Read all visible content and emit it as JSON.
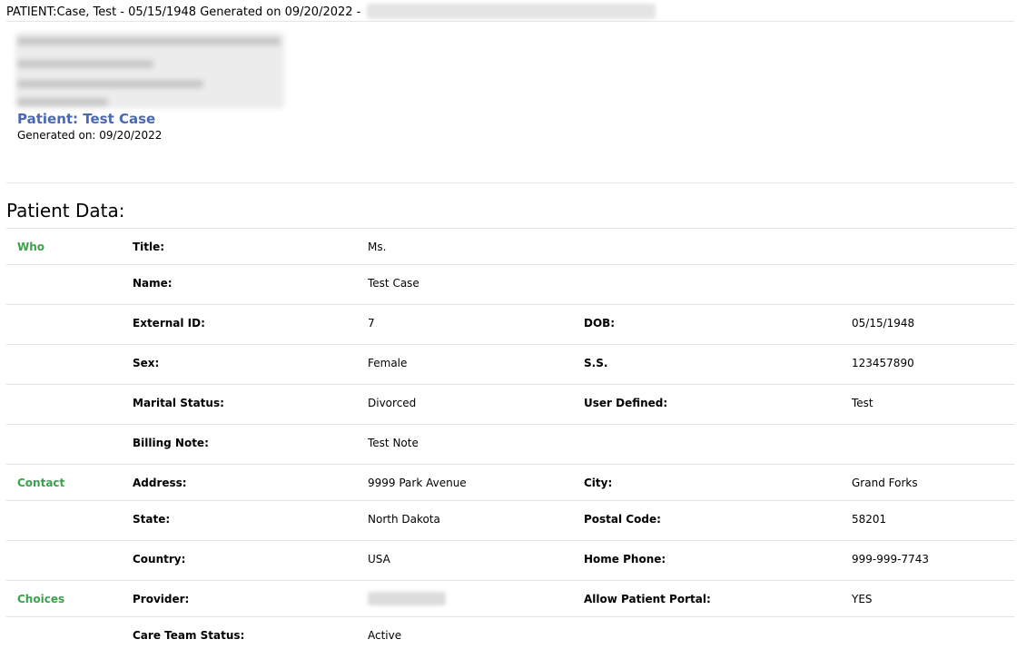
{
  "top_bar": {
    "text": "PATIENT:Case, Test - 05/15/1948 Generated on 09/20/2022 -"
  },
  "header": {
    "patient_title": "Patient: Test Case",
    "generated_on": "Generated on: 09/20/2022"
  },
  "section": {
    "heading": "Patient Data:"
  },
  "rows": [
    {
      "group": "Who",
      "label1": "Title:",
      "value1": "Ms.",
      "label2": "",
      "value2": ""
    },
    {
      "group": "",
      "label1": "Name:",
      "value1": "Test Case",
      "label2": "",
      "value2": ""
    },
    {
      "group": "",
      "label1": "External ID:",
      "value1": "7",
      "label2": "DOB:",
      "value2": "05/15/1948"
    },
    {
      "group": "",
      "label1": "Sex:",
      "value1": "Female",
      "label2": "S.S.",
      "value2": "123457890"
    },
    {
      "group": "",
      "label1": "Marital Status:",
      "value1": "Divorced",
      "label2": "User Defined:",
      "value2": "Test"
    },
    {
      "group": "",
      "label1": "Billing Note:",
      "value1": "Test Note",
      "label2": "",
      "value2": ""
    },
    {
      "group": "Contact",
      "label1": "Address:",
      "value1": "9999 Park Avenue",
      "label2": "City:",
      "value2": "Grand Forks"
    },
    {
      "group": "",
      "label1": "State:",
      "value1": "North Dakota",
      "label2": "Postal Code:",
      "value2": "58201"
    },
    {
      "group": "",
      "label1": "Country:",
      "value1": "USA",
      "label2": "Home Phone:",
      "value2": "999-999-7743"
    },
    {
      "group": "Choices",
      "label1": "Provider:",
      "value1": "",
      "label2": "Allow Patient Portal:",
      "value2": "YES"
    },
    {
      "group": "",
      "label1": "Care Team Status:",
      "value1": "Active",
      "label2": "",
      "value2": ""
    }
  ],
  "colors": {
    "group_label": "#3aa24a",
    "patient_title": "#4a69b5",
    "row_border": "#e2e2e2"
  }
}
